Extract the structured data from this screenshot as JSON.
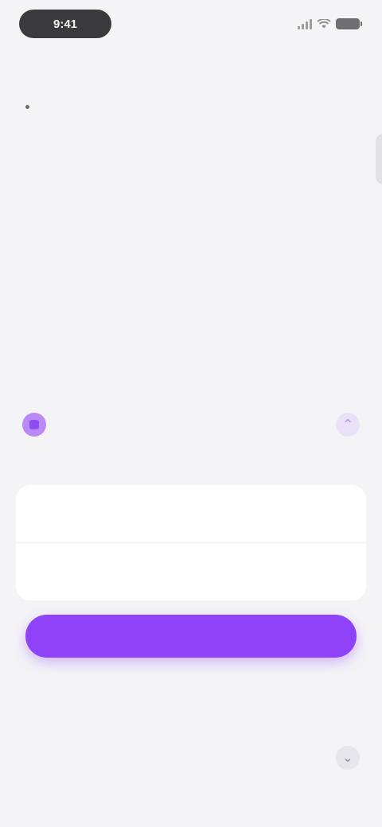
{
  "status_bar": {
    "time": "9:41"
  },
  "article": {
    "kicker": "",
    "body": "",
    "emphasis": "",
    "list_items": [
      ""
    ]
  },
  "signup": {
    "brand_name": "",
    "description_lines": [
      "",
      ""
    ],
    "fine_print": "",
    "fields": [
      {
        "placeholder": ""
      },
      {
        "placeholder": ""
      }
    ],
    "primary_button_label": "",
    "collapse_icon": "chevron-up-icon"
  },
  "footer": {
    "label": "",
    "text": "",
    "icon": "chevron-down-icon"
  },
  "colors": {
    "accent": "#8f42f8",
    "brand": "#8e50ee",
    "background": "#f4f4f6"
  }
}
